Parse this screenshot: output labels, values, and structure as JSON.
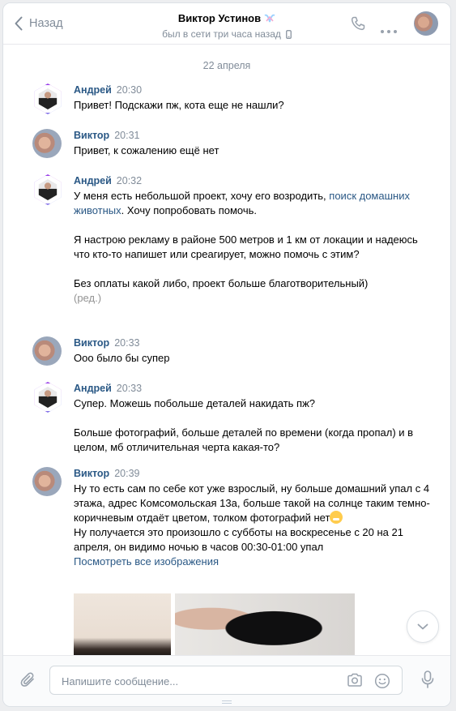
{
  "header": {
    "back_label": "Назад",
    "title": "Виктор Устинов",
    "status": "был в сети три часа назад"
  },
  "feed": {
    "date": "22 апреля",
    "messages": [
      {
        "author": "Андрей",
        "time": "20:30",
        "text": "Привет! Подскажи пж, кота еще не нашли?"
      },
      {
        "author": "Виктор",
        "time": "20:31",
        "text": "Привет, к сожалению ещё нет"
      },
      {
        "author": "Андрей",
        "time": "20:32",
        "p1_before": "У меня есть небольшой проект, хочу его возродить, ",
        "p1_link": "поиск домашних животных",
        "p1_after": ". Хочу попробовать помочь.",
        "p2": "Я настрою рекламу в районе 500 метров и 1 км от локации и надеюсь что кто-то напишет или среагирует, можно помочь с этим?",
        "p3": "Без оплаты какой либо, проект больше благотворительный)",
        "edited": "(ред.)"
      },
      {
        "author": "Виктор",
        "time": "20:33",
        "text": "Ооо было бы супер"
      },
      {
        "author": "Андрей",
        "time": "20:33",
        "p1": "Супер. Можешь побольше деталей накидать пж?",
        "p2": "Больше фотографий, больше деталей по времени (когда пропал) и в целом, мб отличительная черта какая-то?"
      },
      {
        "author": "Виктор",
        "time": "20:39",
        "p1": "Ну то есть сам по себе кот уже взрослый, ну больше домашний упал с 4 этажа, адрес Комсомольская 13а, больше такой на солнце таким темно-коричневым отдаёт цветом, толком фотографий нет",
        "p2": "Ну получается это произошло с субботы на воскресенье с 20 на 21 апреля, он видимо ночью в часов 00:30-01:00 упал",
        "see_all": "Посмотреть все изображения"
      }
    ]
  },
  "composer": {
    "placeholder": "Напишите сообщение..."
  },
  "icons": {
    "back": "chevron-left-icon",
    "call": "phone-icon",
    "more": "more-horizontal-icon",
    "device": "mobile-icon",
    "attach": "paperclip-icon",
    "camera": "camera-icon",
    "emoji": "smile-icon",
    "mic": "microphone-icon",
    "scroll": "chevron-down-icon"
  },
  "colors": {
    "link": "#2a5885",
    "muted": "#818c99",
    "page_bg": "#edeef0"
  }
}
